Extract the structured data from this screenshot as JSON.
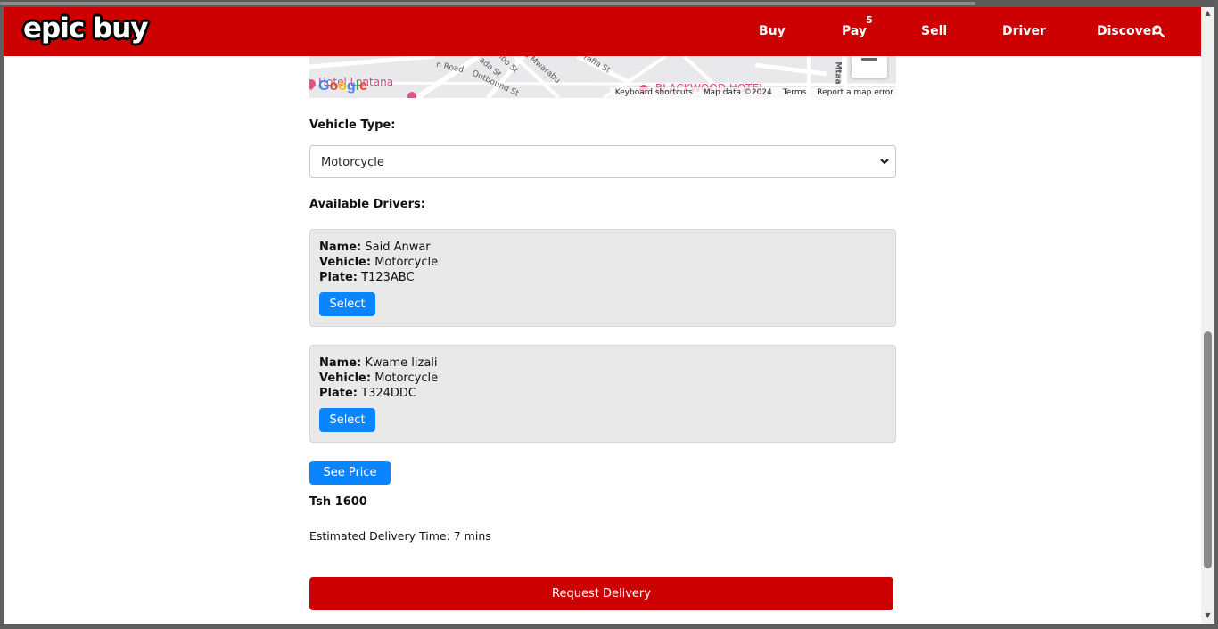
{
  "nav": {
    "logo_text": "epic buy",
    "links": [
      "Buy",
      "Pay",
      "Sell",
      "Driver",
      "Discover"
    ],
    "pay_badge": "5",
    "brand_color": "#cc0000"
  },
  "map": {
    "streets": [
      "n Road",
      "ada St",
      "Outbound St",
      "ibo St",
      "a Mwarabu",
      "rafia St",
      "Mtaa"
    ],
    "hotels": [
      "Hotel Lontana",
      "BLACKWOOD HOTEL"
    ],
    "google": "Google",
    "footer": [
      "Keyboard shortcuts",
      "Map data ©2024",
      "Terms",
      "Report a map error"
    ]
  },
  "form": {
    "vehicle_type_label": "Vehicle Type:",
    "vehicle_type_value": "Motorcycle",
    "available_drivers_label": "Available Drivers:"
  },
  "drivers": [
    {
      "name_label": "Name:",
      "name": "Said Anwar",
      "vehicle_label": "Vehicle:",
      "vehicle": "Motorcycle",
      "plate_label": "Plate:",
      "plate": "T123ABC",
      "select_label": "Select"
    },
    {
      "name_label": "Name:",
      "name": "Kwame lizali",
      "vehicle_label": "Vehicle:",
      "vehicle": "Motorcycle",
      "plate_label": "Plate:",
      "plate": "T324DDC",
      "select_label": "Select"
    }
  ],
  "pricing": {
    "see_price_label": "See Price",
    "price": "Tsh 1600",
    "eta": "Estimated Delivery Time: 7 mins",
    "request_label": "Request Delivery"
  },
  "icons": {
    "search": "search-icon",
    "dropdown": "chevron-down-icon"
  }
}
